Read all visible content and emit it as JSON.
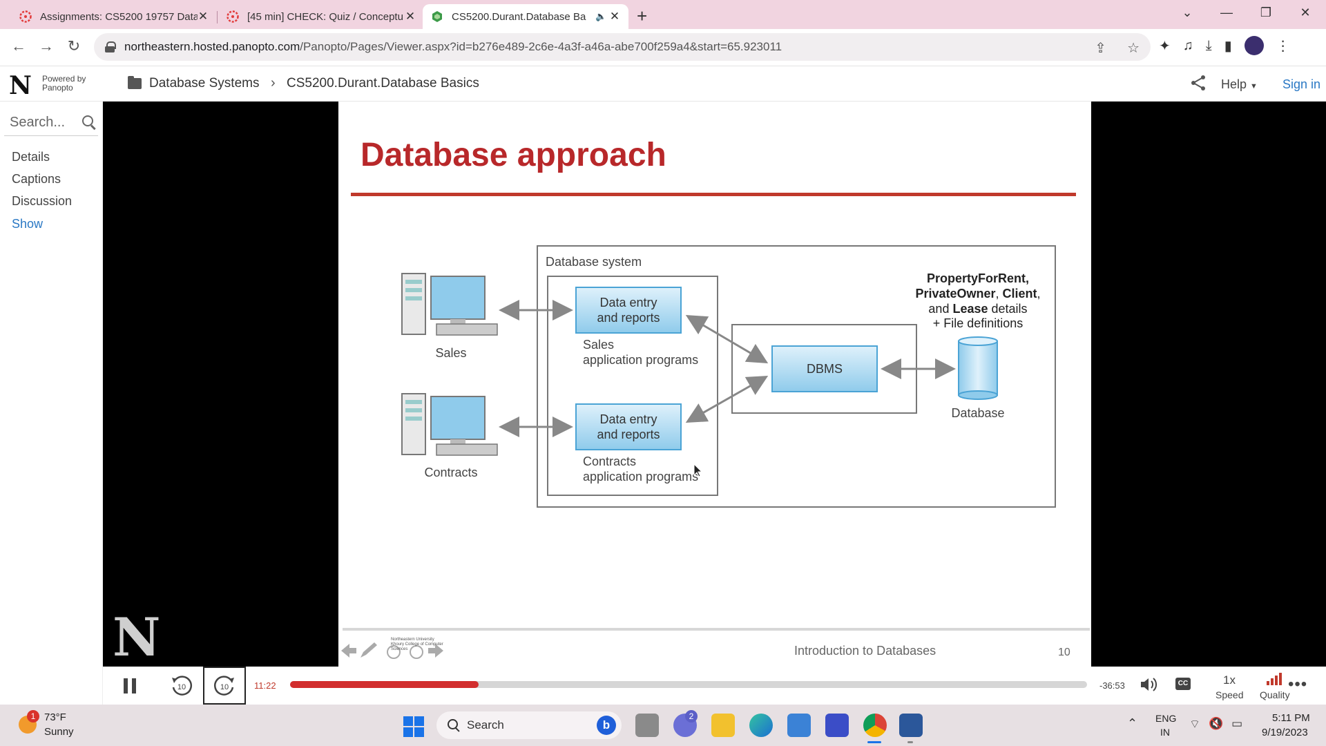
{
  "browser": {
    "tabs": [
      {
        "title": "Assignments: CS5200 19757 Data",
        "icon": "canvas-icon",
        "active": false
      },
      {
        "title": "[45 min] CHECK: Quiz / Conceptu",
        "icon": "canvas-icon",
        "active": false
      },
      {
        "title": "CS5200.Durant.Database Ba",
        "icon": "panopto-icon",
        "active": true,
        "audio": true
      }
    ],
    "url_host": "northeastern.hosted.panopto.com",
    "url_path": "/Panopto/Pages/Viewer.aspx?id=b276e489-2c6e-4a3f-a46a-abe700f259a4&start=65.923011"
  },
  "header": {
    "logo": "N",
    "powered_by": "Powered by",
    "powered_brand": "Panopto",
    "breadcrumb_folder": "Database Systems",
    "breadcrumb_session": "CS5200.Durant.Database Basics",
    "help_label": "Help",
    "signin_label": "Sign in"
  },
  "sidebar": {
    "search_placeholder": "Search...",
    "items": [
      "Details",
      "Captions",
      "Discussion",
      "Show"
    ]
  },
  "slide": {
    "title": "Database approach",
    "diagram": {
      "system_label": "Database system",
      "workstation1_label": "Sales",
      "workstation2_label": "Contracts",
      "box1_line1": "Data entry",
      "box1_line2": "and reports",
      "box2_line1": "Data entry",
      "box2_line2": "and reports",
      "sales_prog_line1": "Sales",
      "sales_prog_line2": "application programs",
      "contracts_prog_line1": "Contracts",
      "contracts_prog_line2": "application programs",
      "dbms_label": "DBMS",
      "database_label": "Database",
      "details_line1": "PropertyForRent,",
      "details_line2a": "PrivateOwner",
      "details_line2b": ", ",
      "details_line2c": "Client",
      "details_line2d": ",",
      "details_line3a": "and ",
      "details_line3b": "Lease",
      "details_line3c": " details",
      "details_line4": "+ File definitions"
    },
    "footer_institution": "Northeastern University Khoury College of Computer Sciences",
    "footer_text": "Introduction to Databases",
    "slide_number": "10"
  },
  "player": {
    "current_time": "11:22",
    "remaining_time": "-36:53",
    "progress_fraction": 0.237,
    "skip_back_label": "10",
    "skip_forward_label": "10",
    "cc_label": "CC",
    "speed_value": "1x",
    "speed_label": "Speed",
    "quality_label": "Quality"
  },
  "taskbar": {
    "weather_badge": "1",
    "temperature": "73°F",
    "condition": "Sunny",
    "search_label": "Search",
    "teams_badge": "2",
    "lang_line1": "ENG",
    "lang_line2": "IN",
    "time": "5:11 PM",
    "date": "9/19/2023"
  },
  "colors": {
    "accent_red": "#d22e2e",
    "slide_title_red": "#b8282a",
    "link_blue": "#2a78c4",
    "tab_strip": "#f1d4e0"
  }
}
